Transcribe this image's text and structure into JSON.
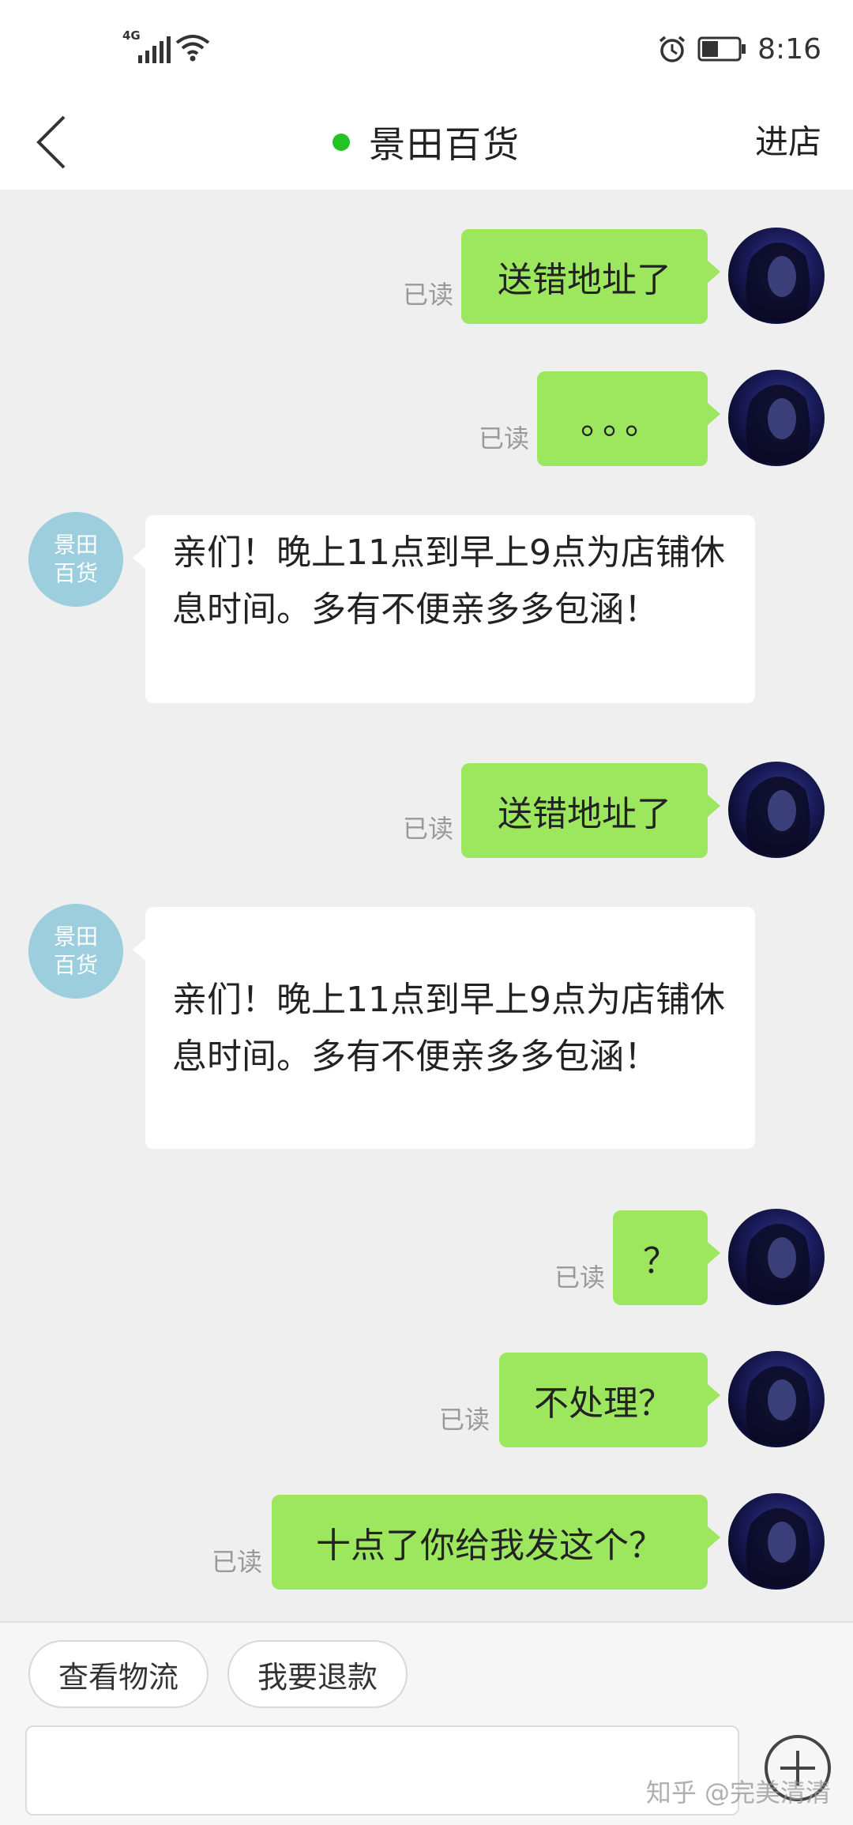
{
  "status_bar": {
    "network": "4G",
    "time": "8:16",
    "icons": [
      "signal-icon",
      "wifi-icon",
      "alarm-icon",
      "battery-icon"
    ]
  },
  "header": {
    "title": "景田百货",
    "enter_shop": "进店",
    "online_color": "#22c322"
  },
  "messages": [
    {
      "from": "me",
      "text": "送错地址了",
      "status": "已读"
    },
    {
      "from": "me",
      "text": "。。。",
      "status": "已读"
    },
    {
      "from": "shop",
      "avatar_line1": "景田",
      "avatar_line2": "百货",
      "text": "亲们！晚上11点到早上9点为店铺休息时间。多有不便亲多多包涵！"
    },
    {
      "from": "me",
      "text": "送错地址了",
      "status": "已读"
    },
    {
      "from": "shop",
      "avatar_line1": "景田",
      "avatar_line2": "百货",
      "text": "亲们！晚上11点到早上9点为店铺休息时间。多有不便亲多多包涵！"
    },
    {
      "from": "me",
      "text": "？",
      "status": "已读"
    },
    {
      "from": "me",
      "text": "不处理？",
      "status": "已读"
    },
    {
      "from": "me",
      "text": "十点了你给我发这个？",
      "status": "已读"
    }
  ],
  "bottom": {
    "quick_buttons": [
      "查看物流",
      "我要退款"
    ],
    "input_value": "",
    "watermark": "知乎 @完美清清"
  },
  "colors": {
    "my_bubble": "#9de75e",
    "shop_avatar": "#9ccedd",
    "background": "#efefef"
  }
}
